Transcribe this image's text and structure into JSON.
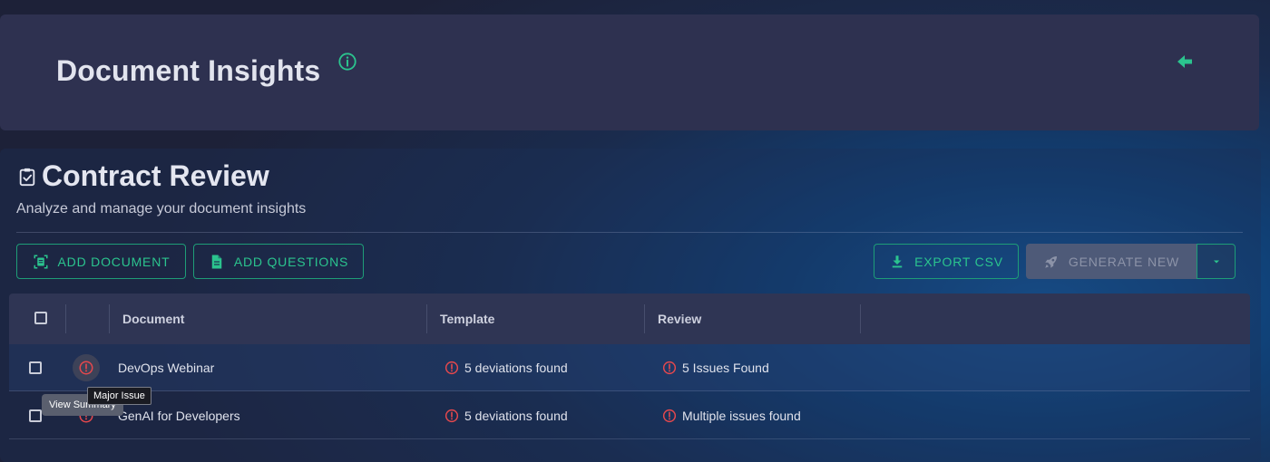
{
  "header": {
    "title": "Document Insights",
    "info_icon": "info-circle-icon",
    "back_icon": "arrow-left-icon"
  },
  "section": {
    "icon": "clipboard-check-icon",
    "title": "Contract Review",
    "subtitle": "Analyze and manage your document insights"
  },
  "toolbar": {
    "add_document_label": "ADD DOCUMENT",
    "add_questions_label": "ADD QUESTIONS",
    "export_csv_label": "EXPORT CSV",
    "generate_new_label": "GENERATE NEW"
  },
  "table": {
    "columns": [
      "Document",
      "Template",
      "Review"
    ],
    "rows": [
      {
        "document": "DevOps Webinar",
        "template": "5 deviations found",
        "review": "5 Issues Found"
      },
      {
        "document": "GenAI for Developers",
        "template": "5 deviations found",
        "review": "Multiple issues found"
      }
    ]
  },
  "tooltips": {
    "view_summary": "View Summary",
    "major_issue": "Major Issue"
  },
  "colors": {
    "accent": "#2bc48e",
    "warning": "#e5484d",
    "header_bg": "#2e3150"
  }
}
